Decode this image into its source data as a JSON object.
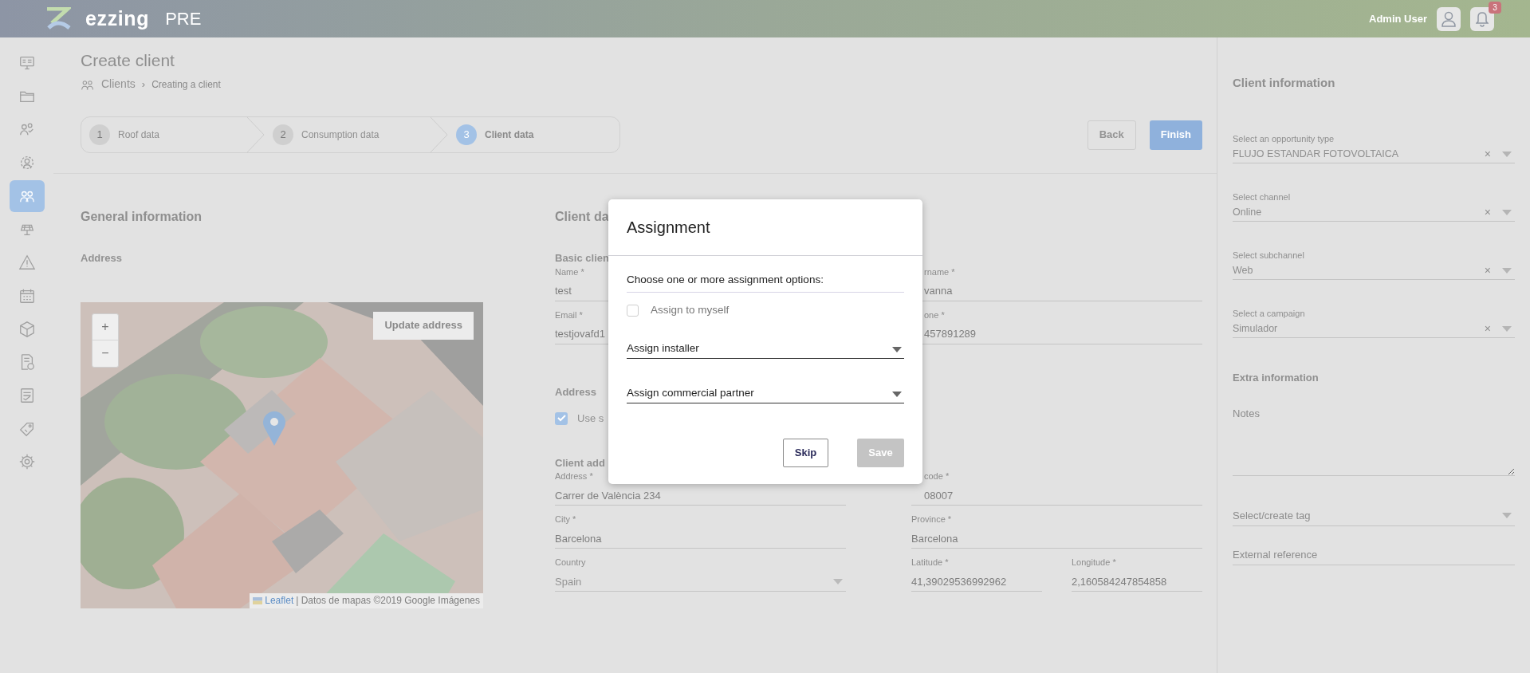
{
  "header": {
    "logo_text": "ezzing",
    "environment": "PRE",
    "user_name": "Admin User",
    "notification_count": "3"
  },
  "sidebar": {
    "items": [
      {
        "selected": false
      },
      {
        "selected": false
      },
      {
        "selected": false
      },
      {
        "selected": false
      },
      {
        "selected": true
      },
      {
        "selected": false
      },
      {
        "selected": false
      },
      {
        "selected": false
      },
      {
        "selected": false
      },
      {
        "selected": false
      },
      {
        "selected": false
      },
      {
        "selected": false
      },
      {
        "selected": false
      }
    ]
  },
  "page": {
    "title": "Create client",
    "breadcrumb": [
      "Clients",
      "Creating a client"
    ],
    "breadcrumb_separator": "›",
    "steps": [
      {
        "number": "1",
        "label": "Roof data",
        "selected": false
      },
      {
        "number": "2",
        "label": "Consumption data",
        "selected": false
      },
      {
        "number": "3",
        "label": "Client data",
        "selected": true
      }
    ],
    "back_button": "Back",
    "finish_button": "Finish"
  },
  "general_information": {
    "heading": "General information",
    "address_label": "Address",
    "map": {
      "zoom_in": "+",
      "zoom_out": "−",
      "update_button": "Update address",
      "attribution_link": "Leaflet",
      "attribution_text": "| Datos de mapas ©2019 Google Imágenes"
    }
  },
  "client_data": {
    "heading": "Client da",
    "basic_heading": "Basic clien",
    "basic_fields": [
      {
        "label": "Name *",
        "value": "test"
      },
      {
        "label": "rname *",
        "value": "vanna",
        "cut": true
      },
      {
        "label": "Email *",
        "value": "testjovafd1"
      },
      {
        "label": "one *",
        "value": "457891289",
        "cut": true
      }
    ],
    "address_heading": "Address",
    "use_same": {
      "label": "Use s",
      "checked": true
    },
    "client_address_heading": "Client add",
    "address_fields": [
      {
        "label": "Address *",
        "value": "Carrer de València 234",
        "kind": "text"
      },
      {
        "label": "code *",
        "value": "08007",
        "cut": true,
        "kind": "text"
      },
      {
        "label": "City *",
        "value": "Barcelona",
        "kind": "text"
      },
      {
        "label": "Province *",
        "value": "Barcelona",
        "kind": "text"
      },
      {
        "label": "Country",
        "value": "Spain",
        "kind": "select"
      },
      {
        "label": "Latitude *",
        "value": "41,39029536992962",
        "kind": "pair"
      },
      {
        "label": "Longitude *",
        "value": "2,160584247854858",
        "kind": "pair"
      }
    ]
  },
  "modal": {
    "title": "Assignment",
    "prompt": "Choose one or more assignment options:",
    "assign_to_myself": {
      "label": "Assign to myself",
      "checked": false
    },
    "selects": [
      "Assign installer",
      "Assign commercial partner"
    ],
    "skip_button": "Skip",
    "save_button": {
      "label": "Save",
      "disabled": true
    }
  },
  "client_information": {
    "heading": "Client information",
    "selects": [
      {
        "label": "Select an opportunity type",
        "value": "FLUJO ESTANDAR FOTOVOLTAICA"
      },
      {
        "label": "Select channel",
        "value": "Online"
      },
      {
        "label": "Select subchannel",
        "value": "Web"
      },
      {
        "label": "Select a campaign",
        "value": "Simulador"
      }
    ],
    "clear_mark": "×",
    "extra_heading": "Extra information",
    "notes_placeholder": "Notes",
    "tag_placeholder": "Select/create tag",
    "external_reference_placeholder": "External reference"
  }
}
